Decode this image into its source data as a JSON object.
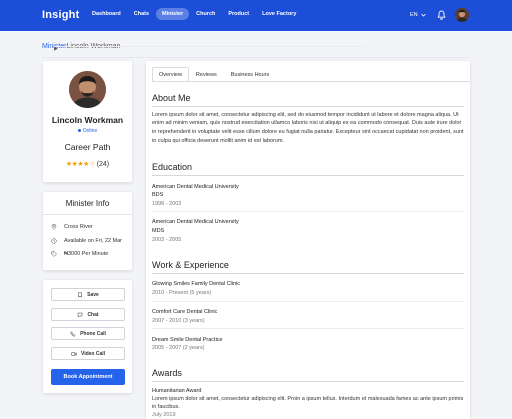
{
  "header": {
    "brand": "Insight",
    "nav": [
      {
        "label": "Dashboard",
        "active": false
      },
      {
        "label": "Chats",
        "active": false
      },
      {
        "label": "Minister",
        "active": true
      },
      {
        "label": "Church",
        "active": false
      },
      {
        "label": "Product",
        "active": false
      },
      {
        "label": "Love Factory",
        "active": false
      }
    ],
    "language": "EN",
    "icons": {
      "bell": "bell-icon",
      "chevron": "chevron-down-icon"
    }
  },
  "breadcrumb": {
    "parent": "Minister",
    "separator": "▶",
    "current": "Lincoln Workman"
  },
  "profile": {
    "name": "Lincoln Workman",
    "status": "Online",
    "title": "Career Path",
    "stars": "★★★★☆",
    "review_count": "(24)"
  },
  "minister_info": {
    "title": "Minister Info",
    "location": "Cross River",
    "availability": "Available on Fri, 22 Mar",
    "rate": "₦3000 Per Minute"
  },
  "actions": {
    "save": "Save",
    "chat": "Chat",
    "phone_call": "Phone Call",
    "video_call": "Video Call",
    "book": "Book Appointment"
  },
  "tabs": [
    {
      "label": "Overview",
      "active": true
    },
    {
      "label": "Reviews",
      "active": false
    },
    {
      "label": "Business Hours",
      "active": false
    }
  ],
  "about": {
    "heading": "About Me",
    "text": "Lorem ipsum dolor sit amet, consectetur adipiscing elit, sed do eiusmod tempor incididunt ut labore et dolore magna aliqua. Ut enim ad minim veniam, quis nostrud exercitation ullamco laboris nisi ut aliquip ex ea commodo consequat. Duis aute irure dolor in reprehenderit in voluptate velit esse cillum dolore eu fugiat nulla pariatur. Excepteur sint occaecat cupidatat non proident, sunt in culpa qui officia deserunt mollit anim id est laborum."
  },
  "education": {
    "heading": "Education",
    "items": [
      {
        "school": "American Dental Medical University",
        "degree": "BDS",
        "years": "1998 - 2003"
      },
      {
        "school": "American Dental Medical University",
        "degree": "MDS",
        "years": "2003 - 2005"
      }
    ]
  },
  "experience": {
    "heading": "Work & Experience",
    "items": [
      {
        "place": "Glowing Smiles Family Dental Clinic",
        "period": "2010 - Present (5 years)"
      },
      {
        "place": "Comfort Care Dental Clinic",
        "period": "2007 - 2010 (3 years)"
      },
      {
        "place": "Dream Smile Dental Practice",
        "period": "2005 - 2007 (2 years)"
      }
    ]
  },
  "awards": {
    "heading": "Awards",
    "items": [
      {
        "title": "Humanitarian Award",
        "text": "Lorem ipsum dolor sit amet, consectetur adipiscing elit. Proin a ipsum tellus. Interdum et malesuada fames ac ante ipsum primis in faucibus.",
        "date": "July 2019"
      }
    ]
  }
}
